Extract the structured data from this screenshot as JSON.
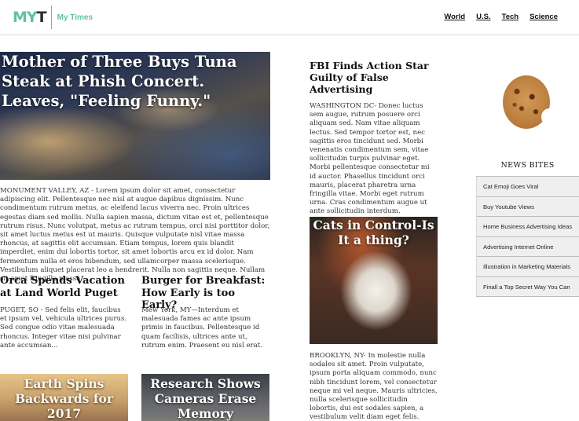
{
  "header": {
    "logo_mark_left": "MY",
    "logo_mark_right": "T",
    "logo_text": "My Times",
    "nav": [
      "World",
      "U.S.",
      "Tech",
      "Science"
    ]
  },
  "hero": {
    "title": "Mother of Three Buys Tuna Steak at Phish Concert. Leaves, \"Feeling Funny.\"",
    "body": "MONUMENT VALLEY, AZ - Lorem ipsum dolor sit amet, consectetur adipiscing elit. Pellentesque nec nisl at augue dapibus dignissim. Nunc condimentum rutrum metus, ac eleifend lacus viverra nec. Proin ultrices egestas diam sed mollis. Nulla sapien massa, dictum vitae est et, pellentesque rutrum risus. Nunc volutpat, metus ac rutrum tempus, orci nisi porttitor dolor, sit amet luctus metus est ut mauris. Quisque vulputate nisl vitae massa rhoncus, at sagittis elit accumsan. Etiam tempus, lorem quis blandit imperdiet, enim dui lobortis tortor, sit amet lobortis arcu ex id dolor. Nam fermentum nulla et eros bibendum, sed ullamcorper massa scelerisque. Vestibulum aliquet placerat leo a hendrerit. Nulla non sagittis neque. Nullam sit amet fringilla massa."
  },
  "orca": {
    "title": "Orca Spends Vacation at Land World Puget",
    "body": "PUGET, SO - Sed felis elit, faucibus et ipsum vel, vehicula ultrices purus. Sed congue odio vitae malesuada rhoncus. Integer vitae nisi pulvinar ante accumsan..."
  },
  "burger": {
    "title": "Burger for Breakfast: How Early is too Early?",
    "body": "Mew York, MY—Interdum et malesuada fames ac ante ipsum primis in faucibus. Pellentesque id quam facilisis, ultrices ante ut, rutrum enim. Praesent eu nisl erat."
  },
  "fbi": {
    "title": "FBI Finds Action Star Guilty of False Advertising",
    "body": "WASHINGTON DC- Donec luctus sem augue, rutrum posuere orci aliquam sed. Nam vitae aliquam lectus. Sed tempor tortor est, nec sagittis eros tincidunt sed. Morbi venenatis condimentum sem, vitae sollicitudin turpis pulvinar eget. Morbi pellentesque consectetur mi id auctor. Phasellus tincidunt orci mauris, placerat pharetra urna fringilla vitae. Morbi eget rutrum urna. Cras condimentum augue ut ante sollicitudin interdum. Pellentesque cursus dolor at tincidunt cursus. Vestibulum blandit aliquam felis..."
  },
  "cats": {
    "title": "Cats in Control-Is It a thing?",
    "body": "BROOKLYN, NY- In molestie nulla sodales sit amet. Proin vulputate, ipsum porta aliquam commodo, nunc nibh tincidunt lorem, vel consectetur neque mi vel neque. Mauris ultricies, nulla scelerisque sollicitudin lobortis, dui est sodales sapien, a vestibulum velit diam eget felis. Vivamus dignissim lacinia dolor, quis commodo tellus pellentesque"
  },
  "earth": {
    "title": "Earth Spins Backwards for 2017"
  },
  "cameras": {
    "title": "Research Shows Cameras Erase Memory"
  },
  "sidebar": {
    "title": "NEWS BITES",
    "items": [
      "Cat Emoji Goes Viral",
      "Buy Youtube Views",
      "Home Business Advertising Ideas",
      "Advertising Internet Online",
      "Illustration in Marketing Materials",
      "Finall a Top Secret Way You Can"
    ]
  }
}
